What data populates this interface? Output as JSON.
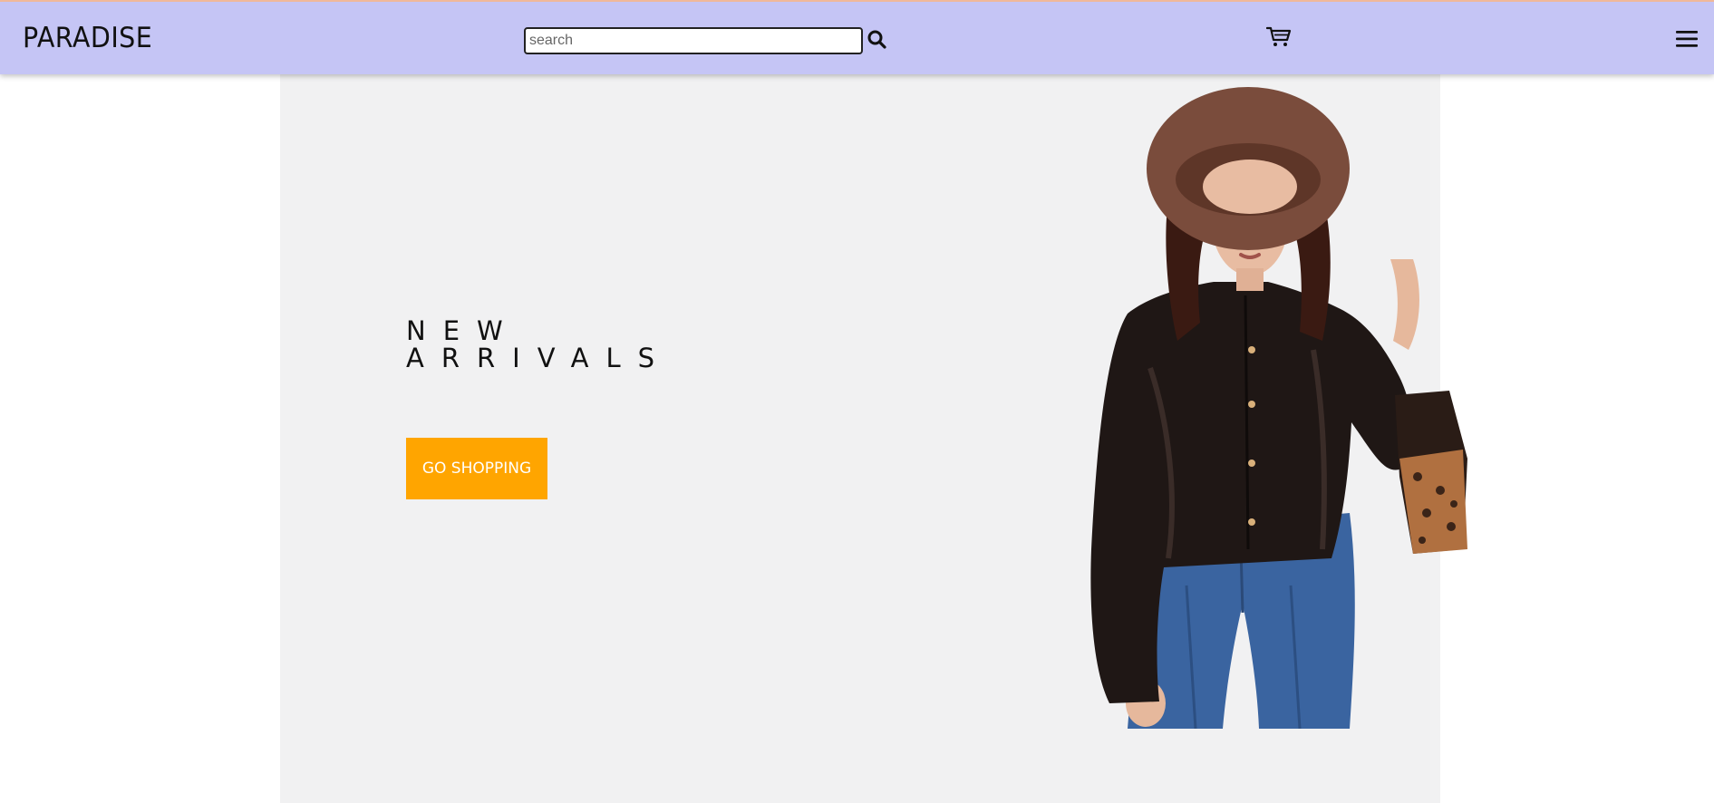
{
  "header": {
    "logo": "PARADISE",
    "search_placeholder": "search",
    "search_value": "",
    "search_icon": "search-icon",
    "cart_icon": "cart-icon",
    "menu_icon": "hamburger-menu-icon",
    "background_color": "#c5c5f5"
  },
  "hero": {
    "headline_line1": "NEW",
    "headline_line2": "ARRIVALS",
    "cta_label": "GO SHOPPING",
    "cta_color": "#ffa500",
    "background_color": "#f1f1f2",
    "image": "fashion-model-photo"
  }
}
